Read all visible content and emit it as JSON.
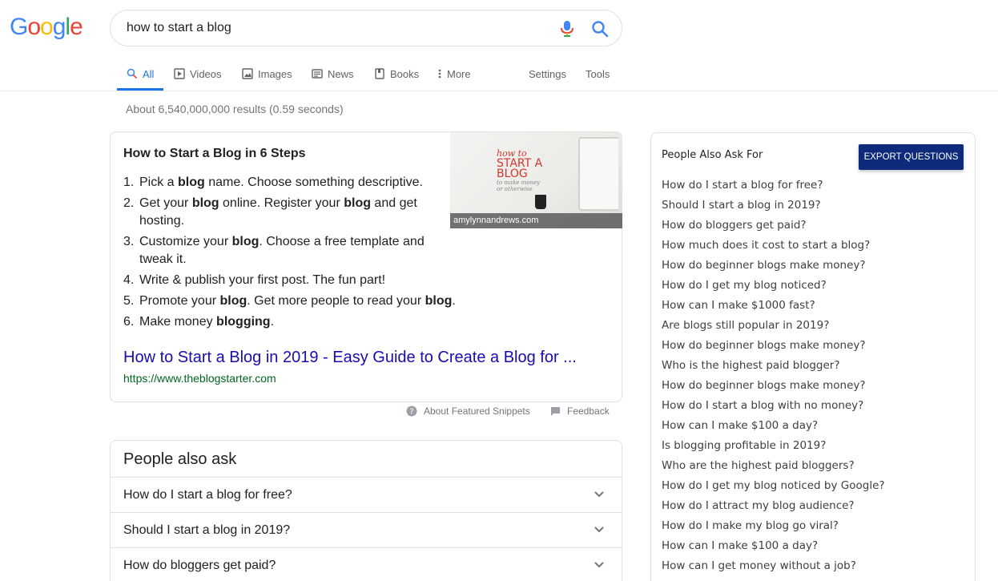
{
  "logo": {
    "letters": [
      "G",
      "o",
      "o",
      "g",
      "l",
      "e"
    ],
    "colors": [
      "#4285F4",
      "#EA4335",
      "#FBBC05",
      "#4285F4",
      "#34A853",
      "#EA4335"
    ]
  },
  "search": {
    "query": "how to start a blog"
  },
  "tabs": [
    {
      "label": "All",
      "icon": "search-icon",
      "active": true
    },
    {
      "label": "Videos",
      "icon": "video-icon"
    },
    {
      "label": "Images",
      "icon": "image-icon"
    },
    {
      "label": "News",
      "icon": "news-icon"
    },
    {
      "label": "Books",
      "icon": "book-icon"
    },
    {
      "label": "More",
      "icon": "more-vertical-icon"
    },
    {
      "label": "Settings"
    },
    {
      "label": "Tools"
    }
  ],
  "stats": "About 6,540,000,000 results (0.59 seconds)",
  "snippet": {
    "title": "How to Start a Blog in 6 Steps",
    "steps": [
      {
        "num": "1.",
        "html": "Pick a <b>blog</b> name. Choose something descriptive."
      },
      {
        "num": "2.",
        "html": "Get your <b>blog</b> online. Register your <b>blog</b> and get hosting."
      },
      {
        "num": "3.",
        "html": "Customize your <b>blog</b>. Choose a free template and tweak it."
      },
      {
        "num": "4.",
        "html": "Write &amp; publish your first post. The fun part!"
      },
      {
        "num": "5.",
        "html": "Promote your <b>blog</b>. Get more people to read your <b>blog</b>."
      },
      {
        "num": "6.",
        "html": "Make money <b>blogging</b>."
      }
    ],
    "image_caption": "amylynnandrews.com",
    "image_text": {
      "line1": "how to",
      "line2": "START A",
      "line3": "BLOG",
      "line4": "to make money",
      "line5": "or otherwise"
    },
    "link_title": "How to Start a Blog in 2019 - Easy Guide to Create a Blog for ...",
    "link_url": "https://www.theblogstarter.com"
  },
  "snippet_footer": {
    "about": "About Featured Snippets",
    "feedback": "Feedback"
  },
  "paa": {
    "title": "People also ask",
    "questions": [
      "How do I start a blog for free?",
      "Should I start a blog in 2019?",
      "How do bloggers get paid?"
    ]
  },
  "side": {
    "title": "People Also Ask For",
    "export_label": "EXPORT QUESTIONS",
    "questions": [
      "How do I start a blog for free?",
      "Should I start a blog in 2019?",
      "How do bloggers get paid?",
      "How much does it cost to start a blog?",
      "How do beginner blogs make money?",
      "How do I get my blog noticed?",
      "How can I make $1000 fast?",
      "Are blogs still popular in 2019?",
      "How do beginner blogs make money?",
      "Who is the highest paid blogger?",
      "How do beginner blogs make money?",
      "How do I start a blog with no money?",
      "How can I make $100 a day?",
      "Is blogging profitable in 2019?",
      "Who are the highest paid bloggers?",
      "How do I get my blog noticed by Google?",
      "How do I attract my blog audience?",
      "How do I make my blog go viral?",
      "How can I make $100 a day?",
      "How can I get money without a job?"
    ]
  }
}
